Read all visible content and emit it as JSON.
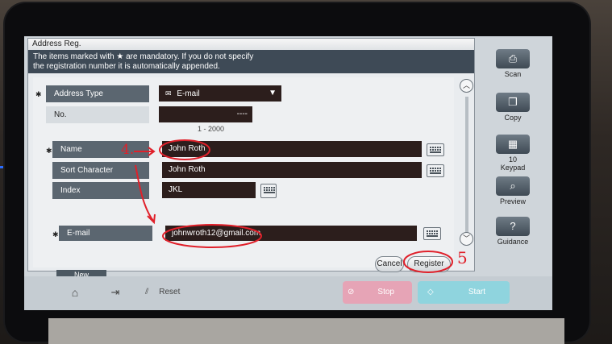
{
  "dialog": {
    "title": "Address Reg.",
    "info_line1": "The items marked with ★ are mandatory. If you do not specify",
    "info_line2": "the registration number it is automatically appended."
  },
  "form": {
    "address_type": {
      "label": "Address Type",
      "value": "E-mail"
    },
    "no": {
      "label": "No.",
      "value": "----",
      "range": "1 - 2000"
    },
    "name": {
      "label": "Name",
      "value": "John Roth"
    },
    "sort_character": {
      "label": "Sort Character",
      "value": "John Roth"
    },
    "index": {
      "label": "Index",
      "value": "JKL"
    },
    "email": {
      "label": "E-mail",
      "value": "johnwroth12@gmail.com"
    }
  },
  "buttons": {
    "cancel": "Cancel",
    "register": "Register",
    "new": "New"
  },
  "side_panel": [
    {
      "label": "Scan",
      "icon": "scan-icon"
    },
    {
      "label": "Copy",
      "icon": "copy-icon"
    },
    {
      "label": "10\nKeypad",
      "label_top": "10",
      "label_bottom": "Keypad",
      "icon": "keypad-icon"
    },
    {
      "label": "Preview",
      "icon": "preview-icon"
    },
    {
      "label": "Guidance",
      "icon": "guidance-icon"
    }
  ],
  "bottom_bar": {
    "reset": "Reset",
    "stop": "Stop",
    "start": "Start"
  },
  "annotations": {
    "step4": "4.",
    "step5": "5"
  },
  "colors": {
    "annotation_red": "#e0202a",
    "field_bg": "#2c1e1c",
    "label_bg": "#5b6670"
  }
}
